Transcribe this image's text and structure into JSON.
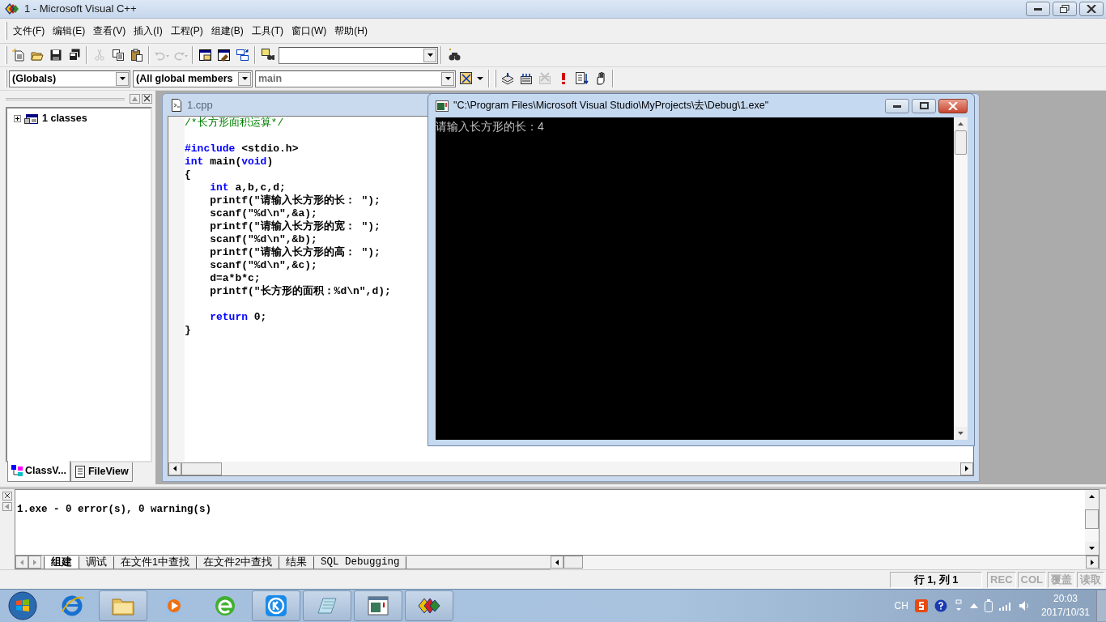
{
  "window": {
    "title": "1 - Microsoft Visual C++"
  },
  "menu": [
    {
      "label": "文件(F)"
    },
    {
      "label": "编辑(E)"
    },
    {
      "label": "查看(V)"
    },
    {
      "label": "插入(I)"
    },
    {
      "label": "工程(P)"
    },
    {
      "label": "组建(B)"
    },
    {
      "label": "工具(T)"
    },
    {
      "label": "窗口(W)"
    },
    {
      "label": "帮助(H)"
    }
  ],
  "toolbar": {
    "buttons": [
      {
        "disabled": false
      },
      {
        "disabled": false
      },
      {
        "disabled": false
      },
      {
        "disabled": false
      },
      {
        "disabled": true
      },
      {
        "disabled": false
      },
      {
        "disabled": false
      },
      {
        "disabled": true
      },
      {
        "disabled": true
      },
      {
        "disabled": false
      },
      {
        "disabled": false
      },
      {
        "disabled": false
      },
      {
        "disabled": false
      }
    ],
    "build_buttons": [
      {
        "disabled": false
      },
      {
        "disabled": false
      },
      {
        "disabled": true
      },
      {
        "disabled": false
      },
      {
        "disabled": false
      },
      {
        "disabled": false
      }
    ]
  },
  "wizard_bar": {
    "scope": "(Globals)",
    "filter": "(All global members",
    "member": "main"
  },
  "workspace": {
    "tree": [
      {
        "label": "1 classes",
        "expanded": false
      }
    ],
    "tabs": [
      {
        "label": "ClassV...",
        "selected": true
      },
      {
        "label": "FileView",
        "selected": false
      }
    ]
  },
  "editor": {
    "title": "1.cpp",
    "blocks": [
      [
        [
          {
            "kind": "comment",
            "text": "/*长方形面积运算*/"
          }
        ]
      ],
      [
        [
          {
            "kind": "keyword",
            "text": "#include"
          },
          {
            "kind": "text",
            "text": " <stdio.h>"
          }
        ],
        [
          {
            "kind": "keyword",
            "text": "int"
          },
          {
            "kind": "text",
            "text": " main("
          },
          {
            "kind": "keyword",
            "text": "void"
          },
          {
            "kind": "text",
            "text": ")"
          }
        ],
        [
          {
            "kind": "text",
            "text": "{"
          }
        ],
        [
          {
            "kind": "keyword",
            "text": "    int"
          },
          {
            "kind": "text",
            "text": " a,b,c,d;"
          }
        ],
        [
          {
            "kind": "text",
            "text": "    printf(\"请输入长方形的长： \");"
          }
        ],
        [
          {
            "kind": "text",
            "text": "    scanf(\"%d\\n\",&a);"
          }
        ],
        [
          {
            "kind": "text",
            "text": "    printf(\"请输入长方形的宽： \");"
          }
        ],
        [
          {
            "kind": "text",
            "text": "    scanf(\"%d\\n\",&b);"
          }
        ],
        [
          {
            "kind": "text",
            "text": "    printf(\"请输入长方形的高： \");"
          }
        ],
        [
          {
            "kind": "text",
            "text": "    scanf(\"%d\\n\",&c);"
          }
        ],
        [
          {
            "kind": "text",
            "text": "    d=a*b*c;"
          }
        ],
        [
          {
            "kind": "text",
            "text": "    printf(\"长方形的面积：%d\\n\",d);"
          }
        ]
      ],
      [
        [
          {
            "kind": "keyword",
            "text": "    return"
          },
          {
            "kind": "text",
            "text": " 0;"
          }
        ],
        [
          {
            "kind": "text",
            "text": "}"
          }
        ]
      ]
    ]
  },
  "console": {
    "title": "\"C:\\Program Files\\Microsoft Visual Studio\\MyProjects\\去\\Debug\\1.exe\"",
    "lines": [
      "请输入长方形的长：4"
    ]
  },
  "output": {
    "text": "1.exe - 0 error(s), 0 warning(s)",
    "tabs": [
      {
        "label": "组建",
        "selected": true
      },
      {
        "label": "调试",
        "selected": false
      },
      {
        "label": "在文件1中查找",
        "selected": false
      },
      {
        "label": "在文件2中查找",
        "selected": false
      },
      {
        "label": "结果",
        "selected": false
      },
      {
        "label": "SQL Debugging",
        "selected": false
      }
    ]
  },
  "status_bar": {
    "position": "行 1, 列 1",
    "indicators": [
      {
        "label": "REC",
        "active": false
      },
      {
        "label": "COL",
        "active": false
      },
      {
        "label": "覆盖",
        "active": false
      },
      {
        "label": "读取",
        "active": false
      }
    ]
  },
  "taskbar": {
    "apps": [
      {
        "running": false
      },
      {
        "running": true
      },
      {
        "running": false
      },
      {
        "running": false
      },
      {
        "running": true
      },
      {
        "running": true
      },
      {
        "running": true
      },
      {
        "running": true
      }
    ],
    "tray_language": "CH",
    "time": "20:03",
    "date": "2017/10/31"
  }
}
